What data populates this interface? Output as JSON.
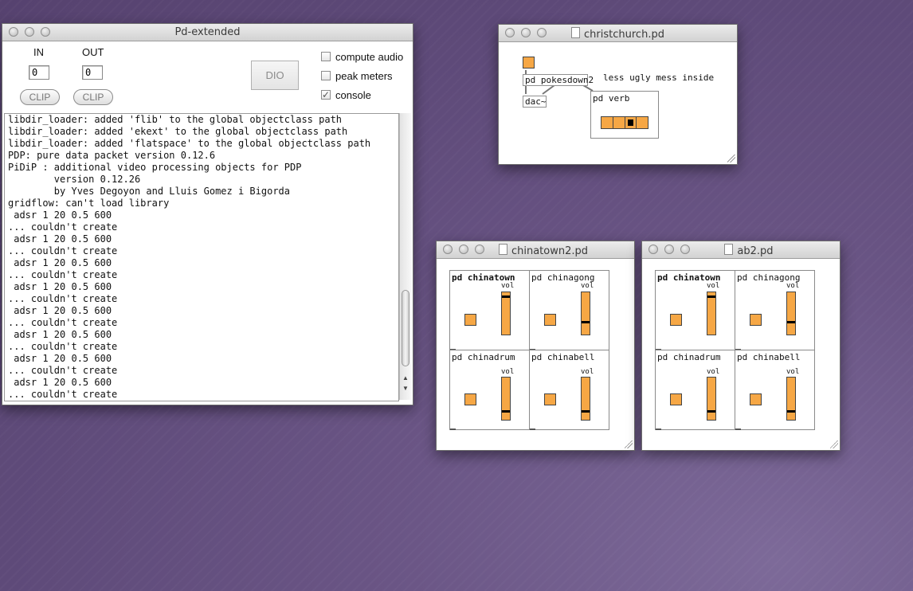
{
  "pd_window": {
    "title": "Pd-extended",
    "in_label": "IN",
    "out_label": "OUT",
    "in_value": "0",
    "out_value": "0",
    "clip_label": "CLIP",
    "dio_label": "DIO",
    "compute_audio": "compute audio",
    "peak_meters": "peak meters",
    "console_label": "console",
    "console_lines": [
      "libdir_loader: added 'flib' to the global objectclass path",
      "libdir_loader: added 'ekext' to the global objectclass path",
      "libdir_loader: added 'flatspace' to the global objectclass path",
      "PDP: pure data packet version 0.12.6",
      "PiDiP : additional video processing objects for PDP",
      "        version 0.12.26",
      "        by Yves Degoyon and Lluis Gomez i Bigorda",
      "gridflow: can't load library",
      " adsr 1 20 0.5 600",
      "... couldn't create",
      " adsr 1 20 0.5 600",
      "... couldn't create",
      " adsr 1 20 0.5 600",
      "... couldn't create",
      " adsr 1 20 0.5 600",
      "... couldn't create",
      " adsr 1 20 0.5 600",
      "... couldn't create",
      " adsr 1 20 0.5 600",
      "... couldn't create",
      " adsr 1 20 0.5 600",
      "... couldn't create",
      " adsr 1 20 0.5 600",
      "... couldn't create"
    ]
  },
  "christchurch": {
    "title": "christchurch.pd",
    "obj_pokesdown": "pd pokesdown2",
    "obj_dac": "dac~",
    "obj_verb": "pd verb",
    "comment": "less ugly mess inside"
  },
  "chinatown2": {
    "title": "chinatown2.pd",
    "subpatches": [
      {
        "name": "pd chinatown",
        "vol": "vol",
        "level": 0.92
      },
      {
        "name": "pd chinagong",
        "vol": "vol",
        "level": 0.28
      },
      {
        "name": "pd chinadrum",
        "vol": "vol",
        "level": 0.18
      },
      {
        "name": "pd chinabell",
        "vol": "vol",
        "level": 0.18
      }
    ]
  },
  "ab2": {
    "title": "ab2.pd",
    "subpatches": [
      {
        "name": "pd chinatown",
        "vol": "vol",
        "level": 0.92
      },
      {
        "name": "pd chinagong",
        "vol": "vol",
        "level": 0.28
      },
      {
        "name": "pd chinadrum",
        "vol": "vol",
        "level": 0.18
      },
      {
        "name": "pd chinabell",
        "vol": "vol",
        "level": 0.18
      }
    ]
  }
}
